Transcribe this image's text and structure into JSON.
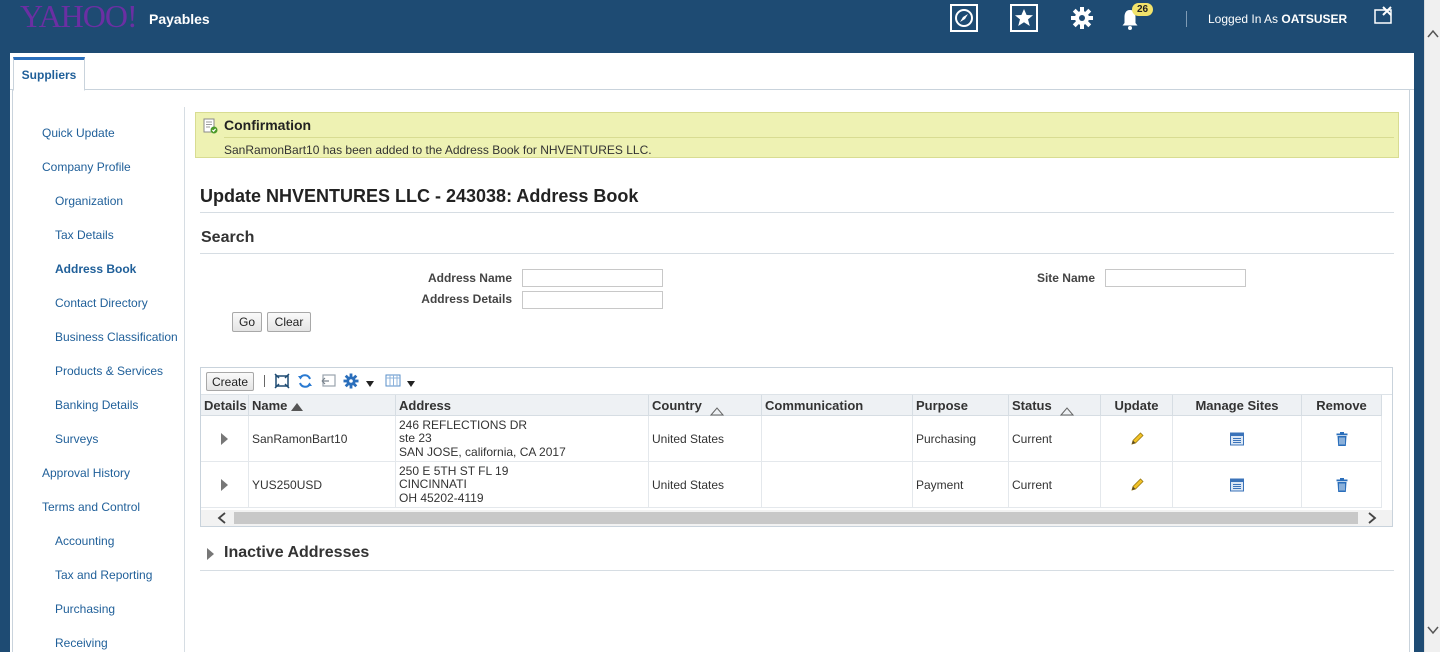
{
  "header": {
    "logo": "YAHOO!",
    "app_title": "Payables",
    "notification_count": "26",
    "logged_in_prefix": "Logged In As ",
    "user": "OATSUSER",
    "icons": [
      "compass-icon",
      "favorites-star-icon",
      "settings-gear-icon",
      "notifications-bell-icon",
      "close-window-icon"
    ]
  },
  "tabs": [
    {
      "label": "Suppliers"
    }
  ],
  "sidebar": {
    "items": [
      {
        "label": "Quick Update"
      },
      {
        "label": "Company Profile"
      },
      {
        "label": "Organization"
      },
      {
        "label": "Tax Details"
      },
      {
        "label": "Address Book"
      },
      {
        "label": "Contact Directory"
      },
      {
        "label": "Business Classification"
      },
      {
        "label": "Products & Services"
      },
      {
        "label": "Banking Details"
      },
      {
        "label": "Surveys"
      },
      {
        "label": "Approval History"
      },
      {
        "label": "Terms and Control"
      },
      {
        "label": "Accounting"
      },
      {
        "label": "Tax and Reporting"
      },
      {
        "label": "Purchasing"
      },
      {
        "label": "Receiving"
      }
    ],
    "active": "Address Book"
  },
  "confirmation": {
    "title": "Confirmation",
    "message": "SanRamonBart10 has been added to the Address Book for NHVENTURES LLC."
  },
  "page": {
    "title": "Update NHVENTURES LLC - 243038: Address Book"
  },
  "search": {
    "title": "Search",
    "address_name_label": "Address Name",
    "address_name_value": "",
    "address_details_label": "Address Details",
    "address_details_value": "",
    "site_name_label": "Site Name",
    "site_name_value": "",
    "go_label": "Go",
    "clear_label": "Clear"
  },
  "table": {
    "create_label": "Create",
    "columns": [
      "Details",
      "Name",
      "Address",
      "Country",
      "Communication",
      "Purpose",
      "Status",
      "Update",
      "Manage Sites",
      "Remove"
    ],
    "rows": [
      {
        "name": "SanRamonBart10",
        "address": [
          "246 REFLECTIONS DR",
          "ste 23",
          "SAN JOSE, california, CA 2017"
        ],
        "country": "United States",
        "communication": "",
        "purpose": "Purchasing",
        "status": "Current"
      },
      {
        "name": "YUS250USD",
        "address": [
          "250 E 5TH ST FL 19",
          "CINCINNATI",
          "OH 45202-4119"
        ],
        "country": "United States",
        "communication": "",
        "purpose": "Payment",
        "status": "Current"
      }
    ]
  },
  "inactive": {
    "label": "Inactive Addresses"
  },
  "colors": {
    "header_bg": "#1e4b73",
    "link": "#1f5f99",
    "confirmation_bg": "#eef2b3",
    "badge_bg": "#f2e36b"
  }
}
